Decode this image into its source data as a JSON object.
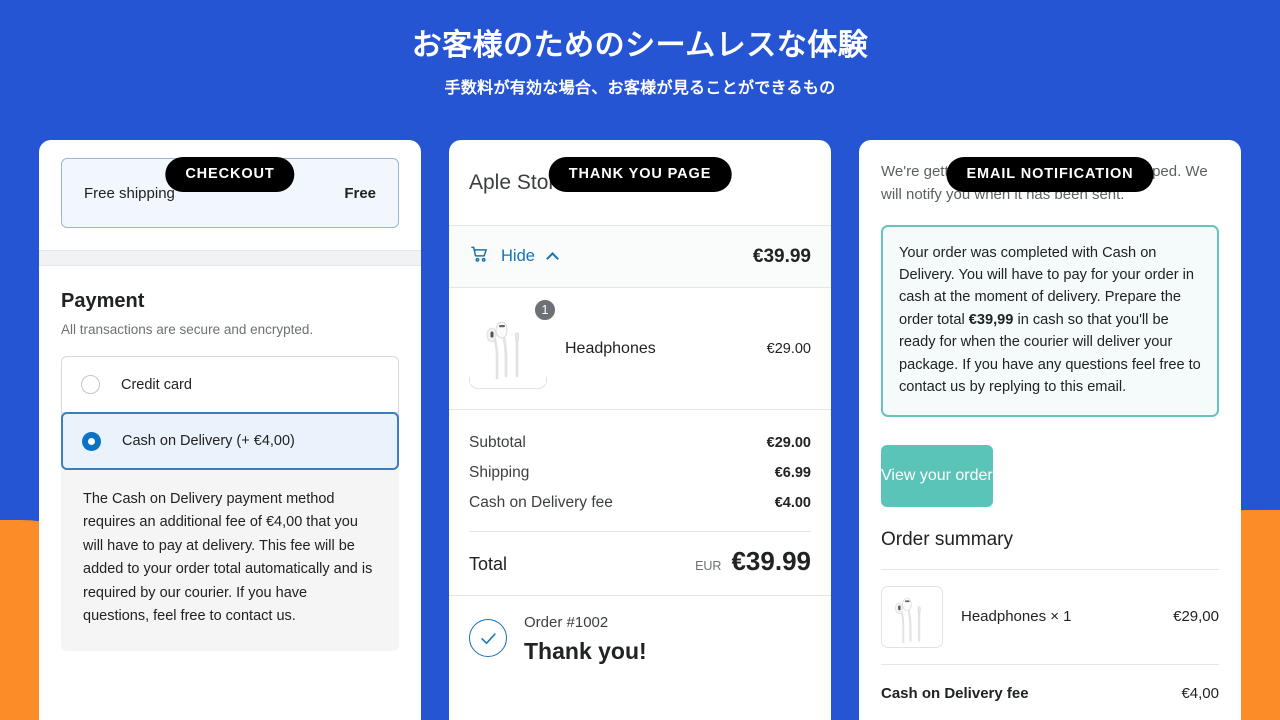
{
  "header": {
    "title": "お客様のためのシームレスな体験",
    "subtitle": "手数料が有効な場合、お客様が見ることができるもの"
  },
  "colors": {
    "background_blue": "#2655d4",
    "accent_orange": "#fc8c28",
    "link_blue": "#1773b0",
    "teal": "#5bc4b8",
    "teal_border": "#63c5bb"
  },
  "checkout_card": {
    "badge": "CHECKOUT",
    "shipping_row": {
      "label": "Free shipping",
      "price": "Free"
    },
    "payment_title": "Payment",
    "payment_subtitle": "All transactions are secure and encrypted.",
    "methods": [
      {
        "label": "Credit card",
        "selected": false
      },
      {
        "label": "Cash on Delivery (+ €4,00)",
        "selected": true
      }
    ],
    "cod_note": "The Cash on Delivery payment method requires an additional fee of €4,00 that you will have to pay at delivery. This fee will be added to your order total automatically and is required by our courier. If you have questions, feel free to contact us."
  },
  "thankyou_card": {
    "badge": "THANK YOU PAGE",
    "store_name": "Aple Store",
    "cart_toggle_label": "Hide",
    "cart_total": "€39.99",
    "line_items": [
      {
        "name": "Headphones",
        "qty": "1",
        "price": "€29.00"
      }
    ],
    "totals": [
      {
        "label": "Subtotal",
        "value": "€29.00"
      },
      {
        "label": "Shipping",
        "value": "€6.99"
      },
      {
        "label": "Cash on Delivery fee",
        "value": "€4.00"
      }
    ],
    "grand_total": {
      "label": "Total",
      "currency": "EUR",
      "value": "€39.99"
    },
    "order_number": "Order #1002",
    "thanks_text": "Thank you!"
  },
  "email_card": {
    "badge": "EMAIL NOTIFICATION",
    "intro": "We're getting your order ready to be shipped. We will notify you when it has been sent.",
    "callout_part1": "Your order was completed with Cash on Delivery. You will have to pay for your order in cash at the moment of delivery. Prepare the order total ",
    "callout_amount": "€39,99",
    "callout_part2": " in cash so that you'll be ready for when the courier will deliver your package. If you have any questions feel free to contact us by replying to this email.",
    "view_order_button": "View your order",
    "summary_title": "Order summary",
    "summary_rows": [
      {
        "name": "Headphones × 1",
        "value": "€29,00"
      },
      {
        "name": "Cash on Delivery fee",
        "value": "€4,00"
      }
    ]
  }
}
